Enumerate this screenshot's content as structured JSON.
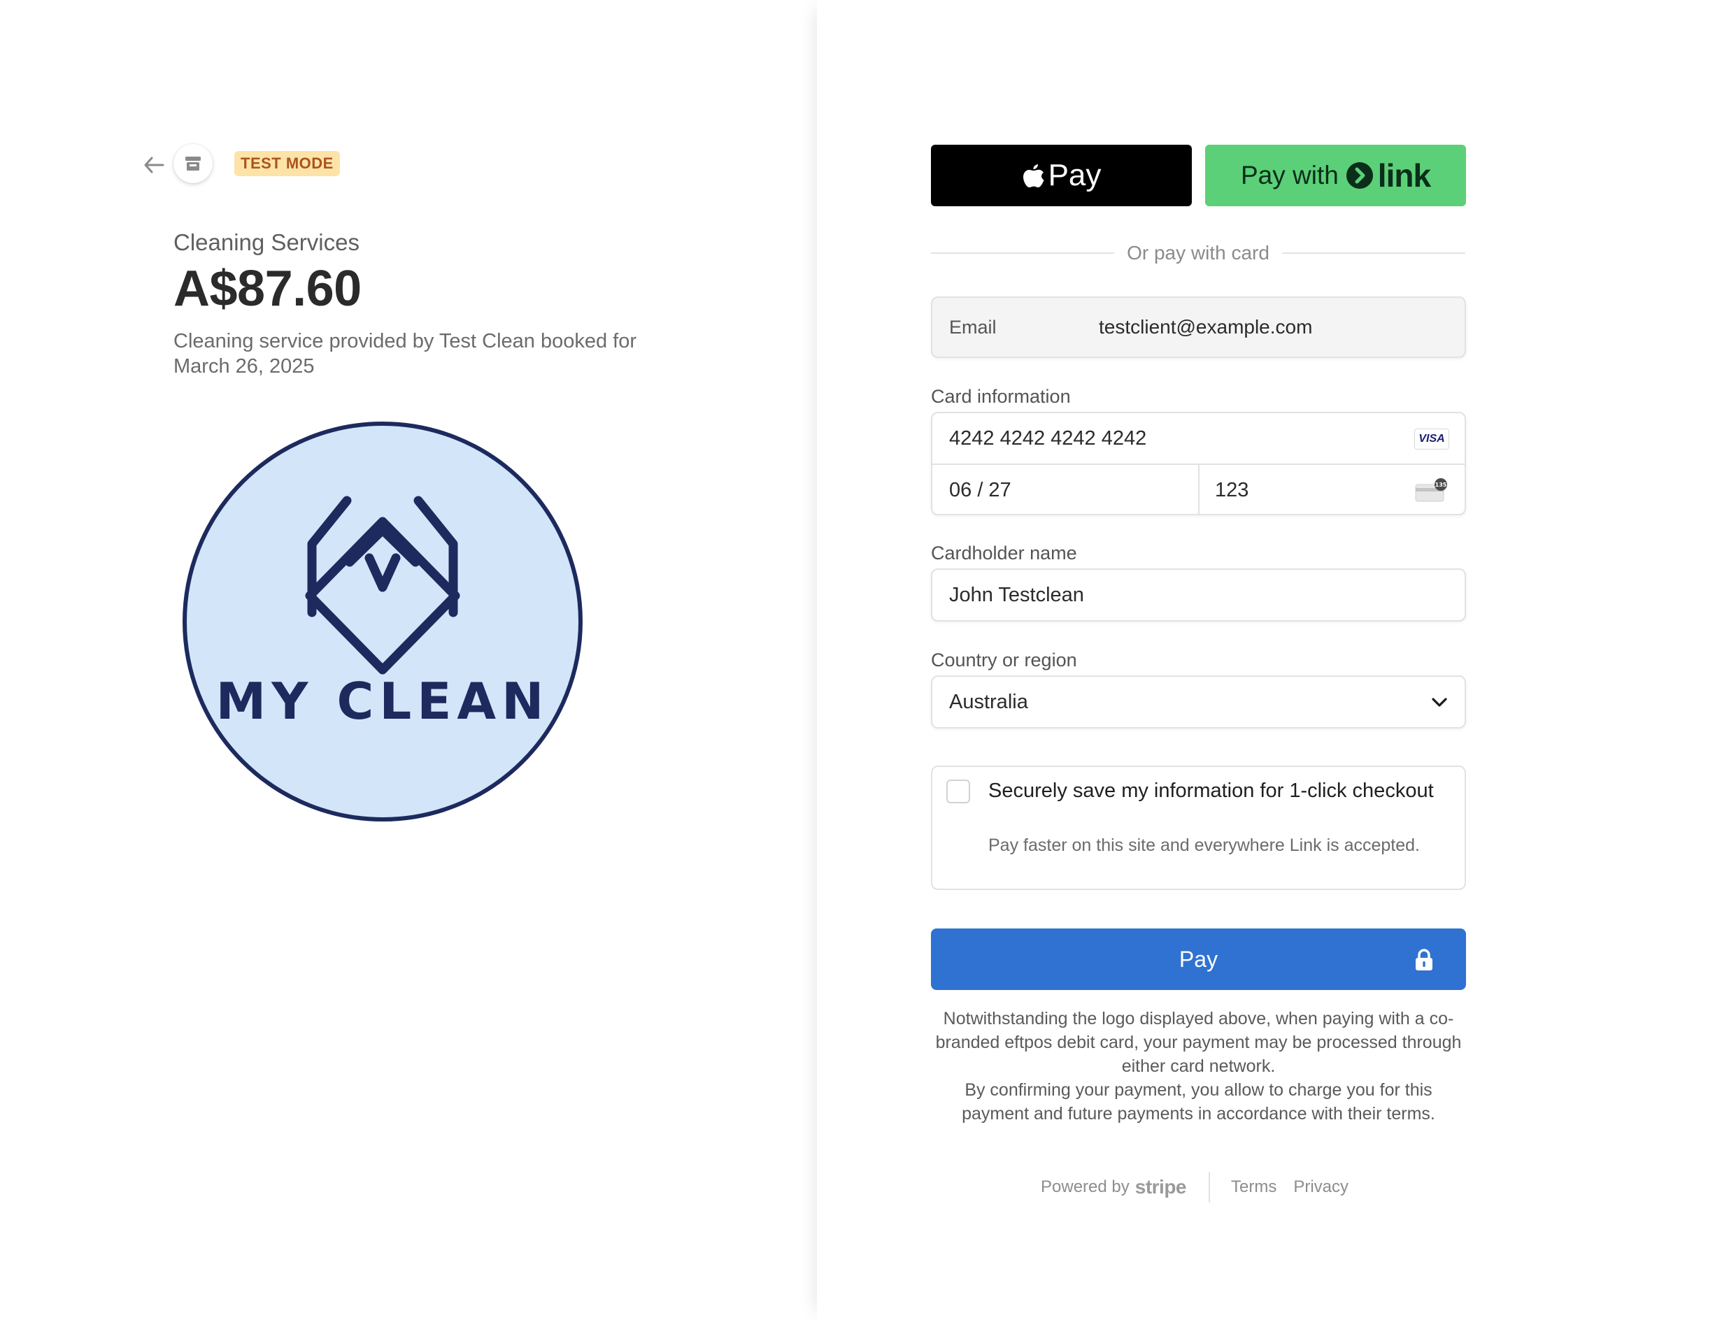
{
  "header": {
    "back_icon": "arrow-left-icon",
    "store_icon": "store-icon",
    "badge": "TEST MODE"
  },
  "product": {
    "name": "Cleaning Services",
    "price": "A$87.60",
    "description": "Cleaning service provided by Test Clean booked for March 26, 2025",
    "logo_text": "MY CLEAN"
  },
  "wallets": {
    "apple_pay_label": "Pay",
    "link_prefix": "Pay with",
    "link_word": "link"
  },
  "divider_text": "Or pay with card",
  "email": {
    "label": "Email",
    "value": "testclient@example.com"
  },
  "card": {
    "label": "Card information",
    "number": "4242 4242 4242 4242",
    "expiry": "06 / 27",
    "cvc": "123",
    "brand": "VISA",
    "cvc_icon_text": "135"
  },
  "cardholder": {
    "label": "Cardholder name",
    "value": "John Testclean"
  },
  "country": {
    "label": "Country or region",
    "value": "Australia"
  },
  "save_info": {
    "checked": false,
    "title": "Securely save my information for 1-click checkout",
    "subtitle": "Pay faster on this site and everywhere Link is accepted."
  },
  "pay_button": {
    "label": "Pay"
  },
  "legal": {
    "line1": "Notwithstanding the logo displayed above, when paying with a co-branded eftpos debit card, your payment may be processed through either card network.",
    "line2": "By confirming your payment, you allow to charge you for this payment and future payments in accordance with their terms."
  },
  "footer": {
    "powered_by": "Powered by",
    "brand": "stripe",
    "terms": "Terms",
    "privacy": "Privacy"
  },
  "colors": {
    "badge_bg": "#fde3a7",
    "badge_text": "#a9551d",
    "link_green": "#5bd078",
    "pay_blue": "#2f72d1",
    "logo_fill": "#d3e5f8",
    "logo_navy": "#1c2a5e"
  }
}
